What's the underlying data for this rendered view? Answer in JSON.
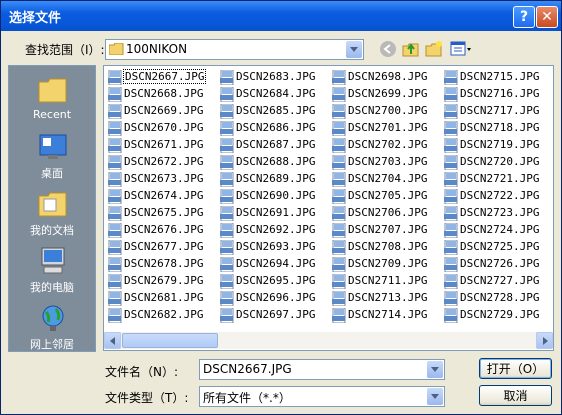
{
  "window": {
    "title": "选择文件",
    "help": "?",
    "close": "✕"
  },
  "lookin": {
    "label": "查找范围（I）:",
    "value": "100NIKON"
  },
  "places": [
    {
      "name": "recent",
      "label": "Recent"
    },
    {
      "name": "desktop",
      "label": "桌面"
    },
    {
      "name": "documents",
      "label": "我的文档"
    },
    {
      "name": "computer",
      "label": "我的电脑"
    },
    {
      "name": "network",
      "label": "网上邻居"
    }
  ],
  "files": {
    "col1": [
      "DSCN2667.JPG",
      "DSCN2668.JPG",
      "DSCN2669.JPG",
      "DSCN2670.JPG",
      "DSCN2671.JPG",
      "DSCN2672.JPG",
      "DSCN2673.JPG",
      "DSCN2674.JPG",
      "DSCN2675.JPG",
      "DSCN2676.JPG",
      "DSCN2677.JPG",
      "DSCN2678.JPG",
      "DSCN2679.JPG",
      "DSCN2681.JPG",
      "DSCN2682.JPG"
    ],
    "col2": [
      "DSCN2683.JPG",
      "DSCN2684.JPG",
      "DSCN2685.JPG",
      "DSCN2686.JPG",
      "DSCN2687.JPG",
      "DSCN2688.JPG",
      "DSCN2689.JPG",
      "DSCN2690.JPG",
      "DSCN2691.JPG",
      "DSCN2692.JPG",
      "DSCN2693.JPG",
      "DSCN2694.JPG",
      "DSCN2695.JPG",
      "DSCN2696.JPG",
      "DSCN2697.JPG"
    ],
    "col3": [
      "DSCN2698.JPG",
      "DSCN2699.JPG",
      "DSCN2700.JPG",
      "DSCN2701.JPG",
      "DSCN2702.JPG",
      "DSCN2703.JPG",
      "DSCN2704.JPG",
      "DSCN2705.JPG",
      "DSCN2706.JPG",
      "DSCN2707.JPG",
      "DSCN2708.JPG",
      "DSCN2709.JPG",
      "DSCN2711.JPG",
      "DSCN2713.JPG",
      "DSCN2714.JPG"
    ],
    "col4": [
      "DSCN2715.JPG",
      "DSCN2716.JPG",
      "DSCN2717.JPG",
      "DSCN2718.JPG",
      "DSCN2719.JPG",
      "DSCN2720.JPG",
      "DSCN2721.JPG",
      "DSCN2722.JPG",
      "DSCN2723.JPG",
      "DSCN2724.JPG",
      "DSCN2725.JPG",
      "DSCN2726.JPG",
      "DSCN2727.JPG",
      "DSCN2728.JPG",
      "DSCN2729.JPG"
    ]
  },
  "filename": {
    "label": "文件名（N）:",
    "value": "DSCN2667.JPG"
  },
  "filetype": {
    "label": "文件类型（T）:",
    "value": "所有文件（*.*）"
  },
  "buttons": {
    "open": "打开（O）",
    "cancel": "取消"
  },
  "colors": {
    "titlebar": "#0757d8",
    "places_bg": "#7f8c9a",
    "dialog_bg": "#ece9d8"
  }
}
